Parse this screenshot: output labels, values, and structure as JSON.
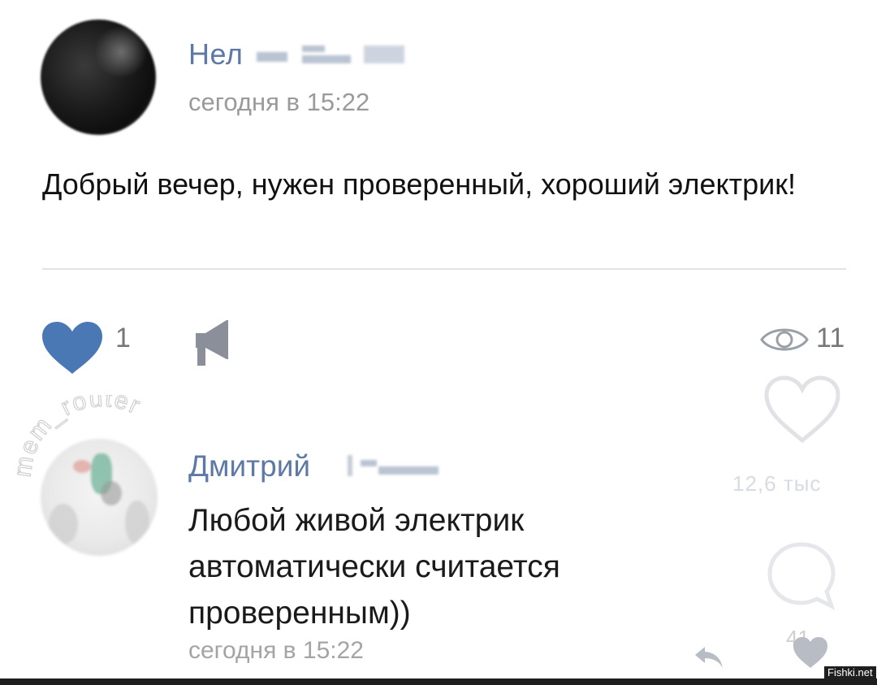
{
  "post": {
    "author_name": "Нел",
    "timestamp": "сегодня в 15:22",
    "text": "Добрый вечер, нужен проверенный, хороший электрик!",
    "likes": "1",
    "views": "11"
  },
  "comment": {
    "author_name": "Дмитрий",
    "text": "Любой живой электрик\nавтоматически считается\nпроверенным))",
    "timestamp": "сегодня в 15:22"
  },
  "overlay": {
    "likes_count": "12,6 тыс",
    "comments_count": "41"
  },
  "watermark": {
    "text": "mem_router"
  },
  "site_mark": "Fishki.net",
  "colors": {
    "link_name": "#5d79a5",
    "like_heart": "#4a78b4",
    "muted_text": "#9a9a9a"
  },
  "icons": [
    "heart-icon",
    "megaphone-share-icon",
    "eye-icon",
    "reply-arrow-icon",
    "comment-bubble-icon"
  ]
}
